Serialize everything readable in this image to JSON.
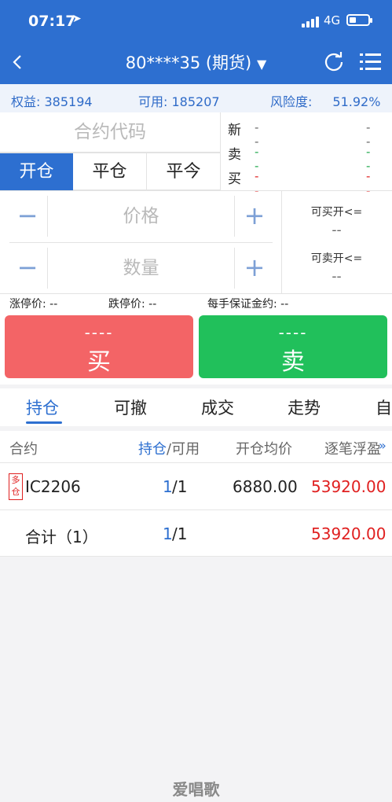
{
  "status": {
    "time": "07:17",
    "network": "4G"
  },
  "header": {
    "title": "80****35 (期货)"
  },
  "account": {
    "equity_label": "权益:",
    "equity": "385194",
    "available_label": "可用:",
    "available": "185207",
    "risk_label": "风险度:",
    "risk": "51.92%"
  },
  "order": {
    "code_placeholder": "合约代码",
    "quote": [
      {
        "label": "新",
        "left": "--",
        "right": "--"
      },
      {
        "label": "卖",
        "left": "--",
        "right": "--"
      },
      {
        "label": "买",
        "left": "--",
        "right": "--"
      }
    ],
    "tabs": [
      "开仓",
      "平仓",
      "平今"
    ],
    "price_placeholder": "价格",
    "qty_placeholder": "数量",
    "buy_open_label": "可买开<=",
    "buy_open_value": "--",
    "sell_open_label": "可卖开<=",
    "sell_open_value": "--",
    "limit_up": "涨停价: --",
    "limit_down": "跌停价: --",
    "margin": "每手保证金约: --",
    "buy_price": "----",
    "buy_label": "买",
    "sell_price": "----",
    "sell_label": "卖"
  },
  "bottom_tabs": [
    "持仓",
    "可撤",
    "成交",
    "走势",
    "自"
  ],
  "table": {
    "headers": {
      "contract": "合约",
      "position": "持仓",
      "available": "/可用",
      "avg_price": "开仓均价",
      "pnl": "逐笔浮盈"
    },
    "rows": [
      {
        "tag": "多仓",
        "contract": "IC2206",
        "pos": "1",
        "avail": "/1",
        "avg": "6880.00",
        "pnl": "53920.00"
      }
    ],
    "total": {
      "label": "合计（1）",
      "pos": "1",
      "avail": "/1",
      "pnl": "53920.00"
    }
  },
  "watermark": "爱唱歌",
  "colors": {
    "primary": "#2d6fd0",
    "buy": "#f36466",
    "sell": "#21c05b",
    "profit": "#e02020"
  }
}
